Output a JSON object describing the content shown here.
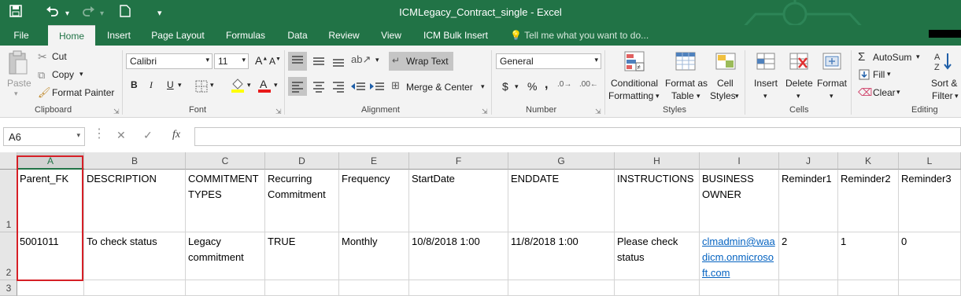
{
  "window": {
    "title": "ICMLegacy_Contract_single - Excel"
  },
  "tabs": [
    "File",
    "Home",
    "Insert",
    "Page Layout",
    "Formulas",
    "Data",
    "Review",
    "View",
    "ICM Bulk Insert"
  ],
  "active_tab": "Home",
  "tell_me": "Tell me what you want to do...",
  "ribbon": {
    "clipboard": {
      "paste": "Paste",
      "cut": "Cut",
      "copy": "Copy",
      "format_painter": "Format Painter",
      "label": "Clipboard"
    },
    "font": {
      "name": "Calibri",
      "size": "11",
      "bold": "B",
      "italic": "I",
      "underline": "U",
      "label": "Font"
    },
    "alignment": {
      "wrap_text": "Wrap Text",
      "merge_center": "Merge & Center",
      "label": "Alignment"
    },
    "number": {
      "format": "General",
      "currency": "$",
      "percent": "%",
      "comma": ",",
      "label": "Number"
    },
    "styles": {
      "conditional_1": "Conditional",
      "conditional_2": "Formatting",
      "format_table_1": "Format as",
      "format_table_2": "Table",
      "cell_styles_1": "Cell",
      "cell_styles_2": "Styles",
      "label": "Styles"
    },
    "cells": {
      "insert": "Insert",
      "delete": "Delete",
      "format": "Format",
      "label": "Cells"
    },
    "editing": {
      "autosum": "AutoSum",
      "fill": "Fill",
      "clear": "Clear",
      "sort_1": "Sort &",
      "sort_2": "Filter",
      "label": "Editing"
    }
  },
  "formula_bar": {
    "name_box": "A6",
    "fx": "fx",
    "content": ""
  },
  "columns": [
    "A",
    "B",
    "C",
    "D",
    "E",
    "F",
    "G",
    "H",
    "I",
    "J",
    "K",
    "L"
  ],
  "selected_column": "A",
  "rows": [
    "1",
    "2",
    "3"
  ],
  "headers": {
    "A": "Parent_FK",
    "B": "DESCRIPTION",
    "C": "COMMITMENT TYPES",
    "D": "Recurring Commitment",
    "E": "Frequency",
    "F": "StartDate",
    "G": "ENDDATE",
    "H": "INSTRUCTIONS",
    "I": "BUSINESS OWNER",
    "J": "Reminder1",
    "K": "Reminder2",
    "L": "Reminder3"
  },
  "row2": {
    "A": "5001011",
    "B": "To check status",
    "C": "Legacy commitment",
    "D": "TRUE",
    "E": "Monthly",
    "F": "10/8/2018 1:00",
    "G": "11/8/2018 1:00",
    "H": "Please check status",
    "I": "clmadmin@waadicm.onmicrosoft.com",
    "J": "2",
    "K": "1",
    "L": "0"
  },
  "colors": {
    "excel_green": "#217346",
    "highlight_red": "#d61f26",
    "link_blue": "#0563c1"
  }
}
